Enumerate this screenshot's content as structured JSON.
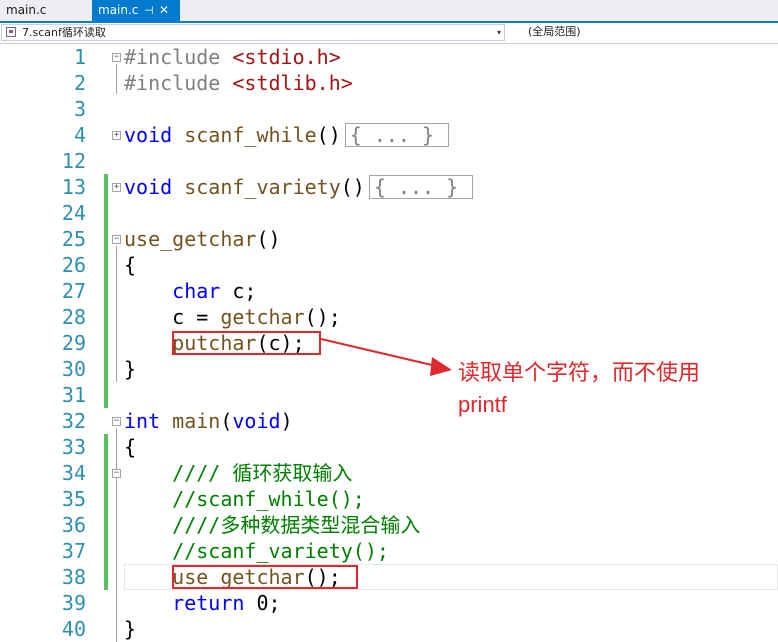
{
  "tabs": [
    {
      "label": "main.c",
      "active": false
    },
    {
      "label": "main.c",
      "active": true,
      "pin": "⊣",
      "close": "✕"
    }
  ],
  "nav": {
    "scope": "7.scanf循环读取",
    "function_scope": "(全局范围)",
    "dropdown_glyph": "▾"
  },
  "editor": {
    "lines": [
      {
        "n": "1",
        "code": "#include <stdio.h>"
      },
      {
        "n": "2",
        "code": "#include <stdlib.h>"
      },
      {
        "n": "3",
        "code": ""
      },
      {
        "n": "4",
        "code": "void scanf_while()"
      },
      {
        "n": "12",
        "code": ""
      },
      {
        "n": "13",
        "code": "void scanf_variety()"
      },
      {
        "n": "24",
        "code": ""
      },
      {
        "n": "25",
        "code": "use_getchar()"
      },
      {
        "n": "26",
        "code": "{"
      },
      {
        "n": "27",
        "code": "    char c;"
      },
      {
        "n": "28",
        "code": "    c = getchar();"
      },
      {
        "n": "29",
        "code": "    putchar(c);"
      },
      {
        "n": "30",
        "code": "}"
      },
      {
        "n": "31",
        "code": ""
      },
      {
        "n": "32",
        "code": "int main(void)"
      },
      {
        "n": "33",
        "code": "{"
      },
      {
        "n": "34",
        "code": "    //// 循环获取输入"
      },
      {
        "n": "35",
        "code": "    //scanf_while();"
      },
      {
        "n": "36",
        "code": "    ////多种数据类型混合输入"
      },
      {
        "n": "37",
        "code": "    //scanf_variety();"
      },
      {
        "n": "38",
        "code": "    use_getchar();"
      },
      {
        "n": "39",
        "code": "    return 0;"
      },
      {
        "n": "40",
        "code": "}"
      }
    ],
    "collapsed_block": "{ ... }"
  },
  "annotation": {
    "text": "读取单个字符，而不使用printf",
    "line1": "读取单个字符，而不使用",
    "line2": "printf"
  },
  "colors": {
    "accent": "#007acc",
    "keyword": "#0000ff",
    "string": "#a31515",
    "comment": "#008000",
    "line_number": "#2b91af",
    "annotation_red": "#e0282d",
    "change_bar": "#57c15f"
  }
}
